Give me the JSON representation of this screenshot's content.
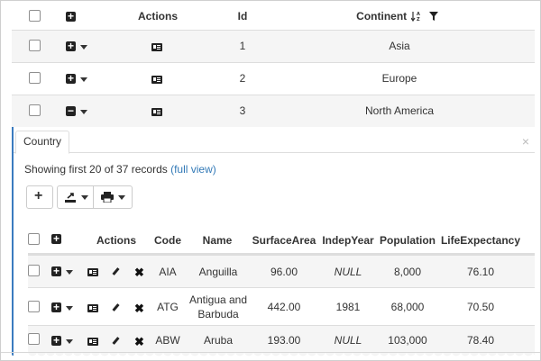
{
  "master": {
    "headers": {
      "actions": "Actions",
      "id": "Id",
      "continent": "Continent"
    },
    "sort_icon": "sort-alpha-icon",
    "filter_icon": "filter-icon",
    "rows": [
      {
        "id": "1",
        "continent": "Asia",
        "expanded": false
      },
      {
        "id": "2",
        "continent": "Europe",
        "expanded": false
      },
      {
        "id": "3",
        "continent": "North America",
        "expanded": true
      }
    ]
  },
  "detail": {
    "tab_label": "Country",
    "summary_text": "Showing first 20 of 37 records ",
    "summary_link": "(full view)",
    "headers": {
      "actions": "Actions",
      "code": "Code",
      "name": "Name",
      "surface": "SurfaceArea",
      "indep": "IndepYear",
      "population": "Population",
      "life": "LifeExpectancy"
    },
    "rows": [
      {
        "code": "AIA",
        "name": "Anguilla",
        "name2": "",
        "surface": "96.00",
        "indep": "NULL",
        "population": "8,000",
        "life": "76.10"
      },
      {
        "code": "ATG",
        "name": "Antigua and",
        "name2": "Barbuda",
        "surface": "442.00",
        "indep": "1981",
        "population": "68,000",
        "life": "70.50"
      },
      {
        "code": "ABW",
        "name": "Aruba",
        "name2": "",
        "surface": "193.00",
        "indep": "NULL",
        "population": "103,000",
        "life": "78.40"
      }
    ]
  },
  "colors": {
    "accent": "#3b7bbf",
    "link": "#337ab7",
    "stripe": "#f5f5f5",
    "border": "#dddddd"
  }
}
